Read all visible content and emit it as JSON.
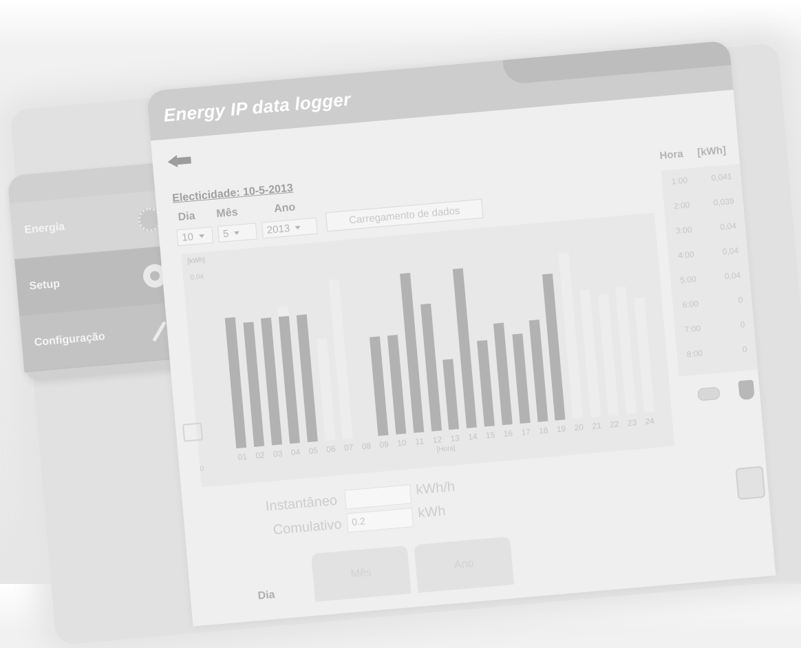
{
  "app": {
    "title": "Energy IP data logger"
  },
  "menu": [
    {
      "label": "Energia",
      "icon": "energy-gear-icon"
    },
    {
      "label": "Setup",
      "icon": "gear-icon"
    },
    {
      "label": "Configuração",
      "icon": "pencil-icon"
    }
  ],
  "header": {
    "section_title": "Electicidade: 10-5-2013"
  },
  "filters": {
    "day_label": "Dia",
    "month_label": "Mês",
    "year_label": "Ano",
    "day_value": "10",
    "month_value": "5",
    "year_value": "2013",
    "load_button": "Carregamento de dados"
  },
  "chart_data": {
    "type": "bar",
    "ylabel": "[kWh]",
    "xlabel": "[Hora]",
    "y_ticks": [
      "0,04",
      "0"
    ],
    "ylim": [
      0,
      0.055
    ],
    "categories": [
      "01",
      "02",
      "03",
      "04",
      "05",
      "06",
      "07",
      "08",
      "09",
      "10",
      "11",
      "12",
      "13",
      "14",
      "15",
      "16",
      "17",
      "18",
      "19",
      "20",
      "21",
      "22",
      "23",
      "24"
    ],
    "values": [
      0.041,
      0.039,
      0.04,
      0.04,
      0.04,
      0,
      0,
      0,
      0.031,
      0.031,
      0.05,
      0.04,
      0.022,
      0.05,
      0.027,
      0.032,
      0.028,
      0.032,
      0.046,
      0,
      0,
      0,
      0,
      0
    ],
    "colors": {
      "active": "#b2b2b2",
      "ghost": "#ededed"
    },
    "ghost_heights": [
      0.037,
      0.036,
      0.033,
      0.043,
      0.04,
      0.032,
      0.05,
      0,
      0,
      0,
      0,
      0,
      0,
      0,
      0,
      0,
      0,
      0,
      0,
      0.052,
      0.04,
      0.038,
      0.04,
      0.036
    ],
    "grid": false
  },
  "table": {
    "headers": [
      "Hora",
      "[kWh]"
    ],
    "rows": [
      {
        "hour": "1:00",
        "kwh": "0,041"
      },
      {
        "hour": "2:00",
        "kwh": "0,039"
      },
      {
        "hour": "3:00",
        "kwh": "0,04"
      },
      {
        "hour": "4:00",
        "kwh": "0,04"
      },
      {
        "hour": "5:00",
        "kwh": "0,04"
      },
      {
        "hour": "6:00",
        "kwh": "0"
      },
      {
        "hour": "7:00",
        "kwh": "0"
      },
      {
        "hour": "8:00",
        "kwh": "0"
      }
    ]
  },
  "readings": {
    "instant_label": "Instantâneo",
    "instant_value": "",
    "instant_unit": "kWh/h",
    "cumulative_label": "Comulativo",
    "cumulative_value": "0.2",
    "cumulative_unit": "kWh"
  },
  "tabs": [
    "Dia",
    "Mês",
    "Ano"
  ]
}
